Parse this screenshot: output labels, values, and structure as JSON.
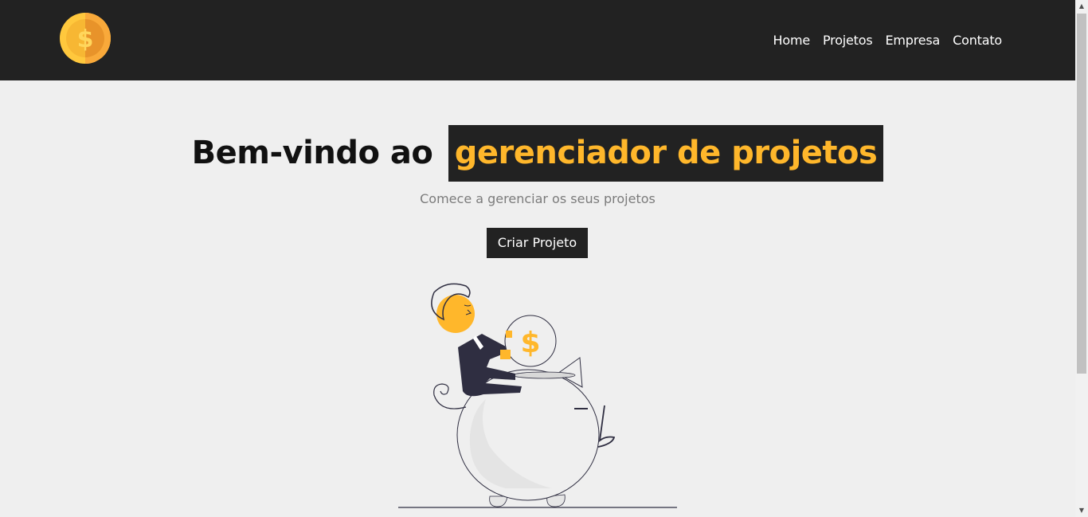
{
  "navbar": {
    "logo_icon": "dollar-coin-icon",
    "links": [
      "Home",
      "Projetos",
      "Empresa",
      "Contato"
    ]
  },
  "hero": {
    "title_prefix": "Bem-vindo ao",
    "title_highlight": "gerenciador de projetos",
    "subtitle": "Comece a gerenciar os seus projetos",
    "cta_label": "Criar Projeto",
    "illustration_coin_symbol": "$"
  },
  "colors": {
    "nav_bg": "#222222",
    "page_bg": "#efefef",
    "accent": "#ffb72b",
    "subtitle": "#7b7b7b"
  }
}
